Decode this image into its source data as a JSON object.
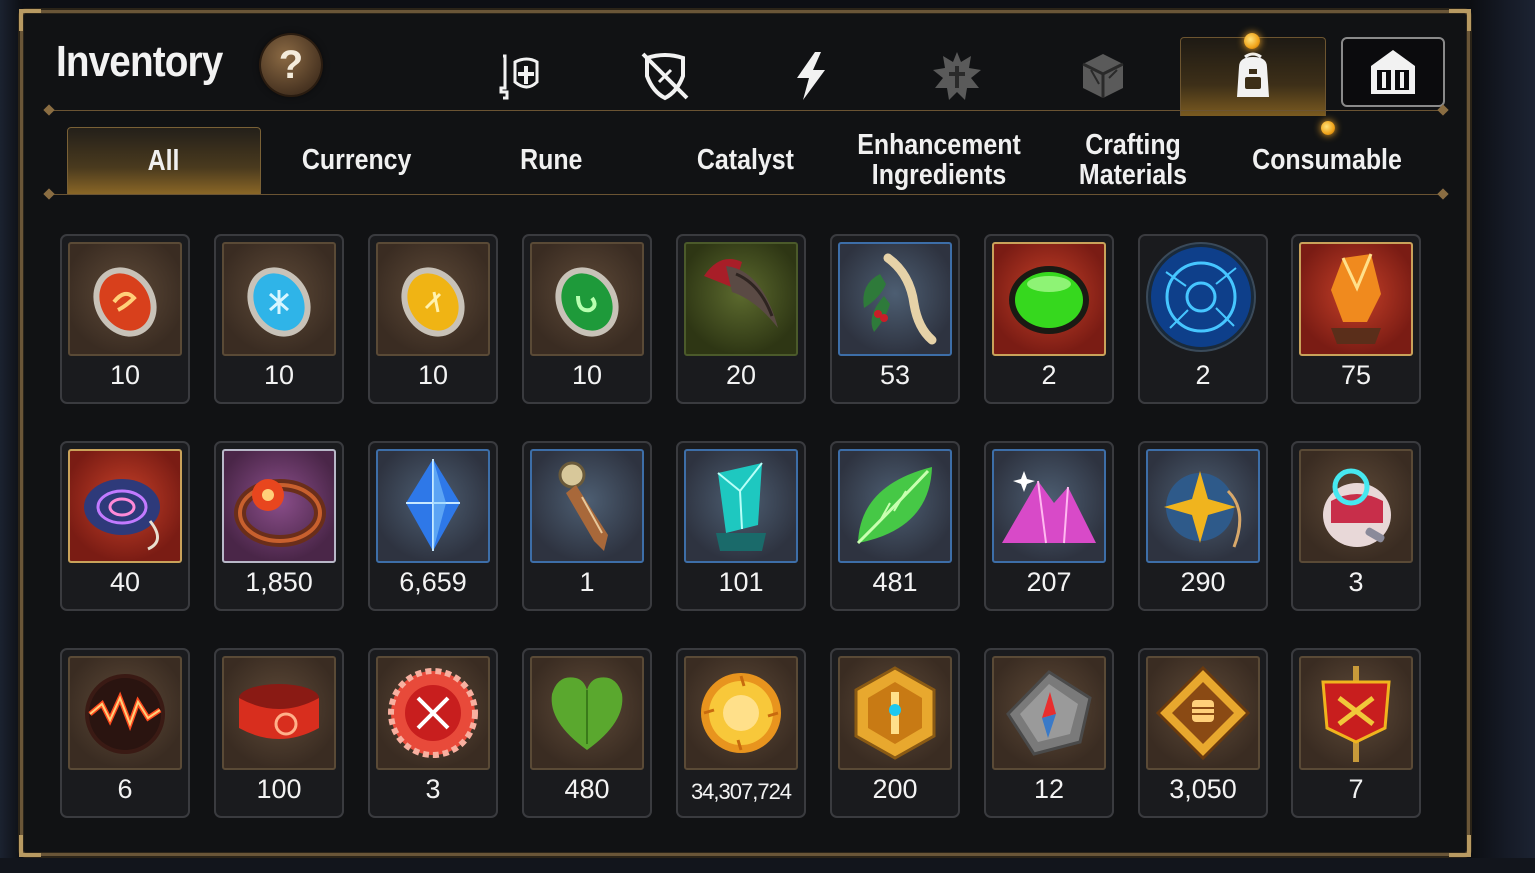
{
  "title": "Inventory",
  "help_label": "?",
  "top_tabs": [
    {
      "icon": "gear-knight-icon"
    },
    {
      "icon": "broken-shield-icon"
    },
    {
      "icon": "lightning-icon"
    },
    {
      "icon": "artifact-icon"
    },
    {
      "icon": "cube-icon"
    },
    {
      "icon": "backpack-icon",
      "active": true
    },
    {
      "icon": "guild-house-icon"
    }
  ],
  "sub_tabs": [
    "All",
    "Currency",
    "Rune",
    "Catalyst",
    "Enhancement Ingredients",
    "Crafting Materials",
    "Consumable"
  ],
  "active_sub_tab": "All",
  "items": [
    {
      "icon": "red-rune-icon",
      "count": "10"
    },
    {
      "icon": "blue-rune-icon",
      "count": "10"
    },
    {
      "icon": "yellow-rune-icon",
      "count": "10"
    },
    {
      "icon": "green-rune-icon",
      "count": "10"
    },
    {
      "icon": "claw-icon",
      "count": "20"
    },
    {
      "icon": "herb-root-icon",
      "count": "53"
    },
    {
      "icon": "green-gem-icon",
      "count": "2"
    },
    {
      "icon": "blue-portal-icon",
      "count": "2"
    },
    {
      "icon": "orange-crystal-icon",
      "count": "75"
    },
    {
      "icon": "blue-coil-icon",
      "count": "40"
    },
    {
      "icon": "flower-ring-icon",
      "count": "1,850"
    },
    {
      "icon": "blue-crystal-icon",
      "count": "6,659"
    },
    {
      "icon": "bookmark-icon",
      "count": "1"
    },
    {
      "icon": "teal-crystal-icon",
      "count": "101"
    },
    {
      "icon": "green-leaf-icon",
      "count": "481"
    },
    {
      "icon": "pink-mountain-icon",
      "count": "207"
    },
    {
      "icon": "star-pendant-icon",
      "count": "290"
    },
    {
      "icon": "robot-toy-icon",
      "count": "3"
    },
    {
      "icon": "lava-orb-icon",
      "count": "6"
    },
    {
      "icon": "red-bracelet-icon",
      "count": "100"
    },
    {
      "icon": "red-badge-icon",
      "count": "3"
    },
    {
      "icon": "green-heart-icon",
      "count": "480"
    },
    {
      "icon": "gold-coin-icon",
      "count": "34,307,724"
    },
    {
      "icon": "gold-hexagon-icon",
      "count": "200"
    },
    {
      "icon": "stone-compass-icon",
      "count": "12"
    },
    {
      "icon": "fist-emblem-icon",
      "count": "3,050"
    },
    {
      "icon": "war-banner-icon",
      "count": "7"
    }
  ]
}
